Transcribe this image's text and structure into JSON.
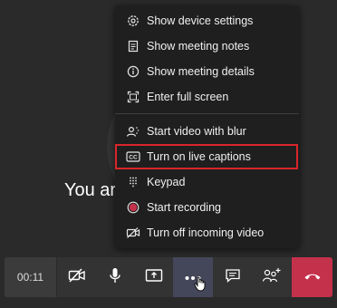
{
  "background": {
    "partial_text": "You ar"
  },
  "menu": {
    "items": [
      {
        "label": "Show device settings",
        "icon": "gear-icon"
      },
      {
        "label": "Show meeting notes",
        "icon": "notes-icon"
      },
      {
        "label": "Show meeting details",
        "icon": "info-icon"
      },
      {
        "label": "Enter full screen",
        "icon": "fullscreen-icon"
      },
      {
        "label": "Start video with blur",
        "icon": "blur-video-icon"
      },
      {
        "label": "Turn on live captions",
        "icon": "cc-icon"
      },
      {
        "label": "Keypad",
        "icon": "keypad-icon"
      },
      {
        "label": "Start recording",
        "icon": "record-icon"
      },
      {
        "label": "Turn off incoming video",
        "icon": "video-off-icon"
      }
    ]
  },
  "toolbar": {
    "timer": "00:11"
  },
  "colors": {
    "highlight": "#d9252a",
    "hangup": "#c4314b",
    "record": "#c4314b"
  }
}
